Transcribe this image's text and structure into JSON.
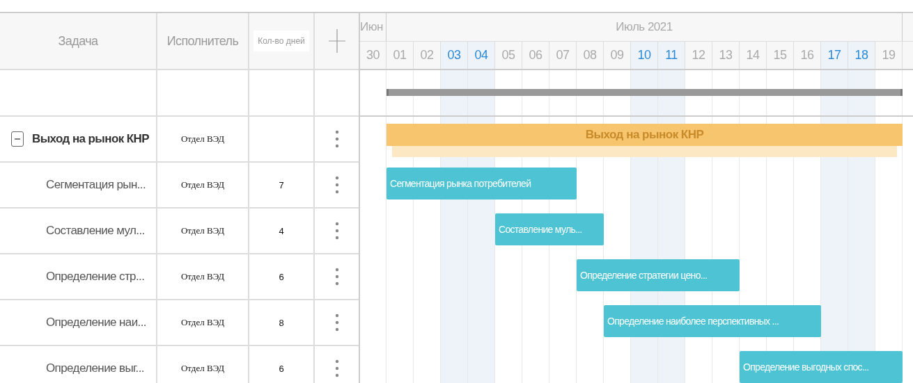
{
  "columns": [
    {
      "label": "Задача"
    },
    {
      "label": "Исполнитель"
    },
    {
      "label": "Кол-во дней"
    }
  ],
  "months": [
    {
      "label": "Июн",
      "days": [
        {
          "label": "30",
          "weekend": false
        }
      ]
    },
    {
      "label": "Июль 2021",
      "days": [
        {
          "label": "01",
          "weekend": false
        },
        {
          "label": "02",
          "weekend": false
        },
        {
          "label": "03",
          "weekend": true
        },
        {
          "label": "04",
          "weekend": true
        },
        {
          "label": "05",
          "weekend": false
        },
        {
          "label": "06",
          "weekend": false
        },
        {
          "label": "07",
          "weekend": false
        },
        {
          "label": "08",
          "weekend": false
        },
        {
          "label": "09",
          "weekend": false
        },
        {
          "label": "10",
          "weekend": true
        },
        {
          "label": "11",
          "weekend": true
        },
        {
          "label": "12",
          "weekend": false
        },
        {
          "label": "13",
          "weekend": false
        },
        {
          "label": "14",
          "weekend": false
        },
        {
          "label": "15",
          "weekend": false
        },
        {
          "label": "16",
          "weekend": false
        },
        {
          "label": "17",
          "weekend": true
        },
        {
          "label": "18",
          "weekend": true
        },
        {
          "label": "19",
          "weekend": false
        }
      ]
    }
  ],
  "project": {
    "name": "Выход на рынок КНР",
    "assignee": "Отдел ВЭД",
    "expanded": true,
    "bar_label": "Выход на рынок КНР",
    "children": [
      {
        "name": "Сегментация рын...",
        "assignee": "Отдел ВЭД",
        "duration": "7",
        "bar_label": "Сегментация рынка потребителей"
      },
      {
        "name": "Составление мул...",
        "assignee": "Отдел ВЭД",
        "duration": "4",
        "bar_label": "Составление муль..."
      },
      {
        "name": "Определение стр...",
        "assignee": "Отдел ВЭД",
        "duration": "6",
        "bar_label": "Определение стратегии цено..."
      },
      {
        "name": "Определение наи...",
        "assignee": "Отдел ВЭД",
        "duration": "8",
        "bar_label": "Определение наиболее перспективных ..."
      },
      {
        "name": "Определение выг...",
        "assignee": "Отдел ВЭД",
        "duration": "6",
        "bar_label": "Определение выгодных спос..."
      }
    ]
  }
}
